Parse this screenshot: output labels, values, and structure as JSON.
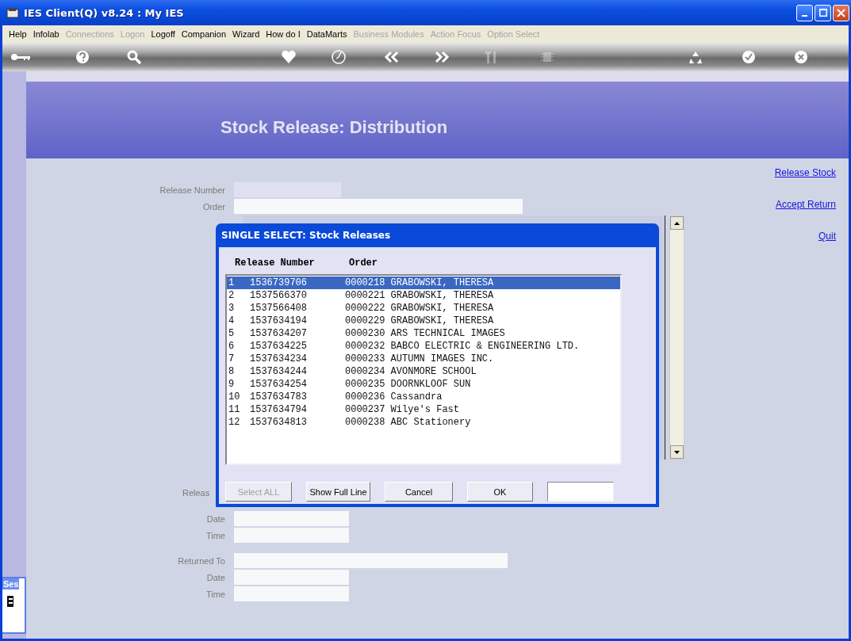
{
  "window": {
    "title": "IES Client(Q) v8.24 : My IES"
  },
  "menu": [
    {
      "label": "Help",
      "disabled": false
    },
    {
      "label": "Infolab",
      "disabled": false
    },
    {
      "label": "Connections",
      "disabled": true
    },
    {
      "label": "Logon",
      "disabled": true
    },
    {
      "label": "Logoff",
      "disabled": false
    },
    {
      "label": "Companion",
      "disabled": false
    },
    {
      "label": "Wizard",
      "disabled": false
    },
    {
      "label": "How do I",
      "disabled": false
    },
    {
      "label": "DataMarts",
      "disabled": false
    },
    {
      "label": "Business Modules",
      "disabled": true
    },
    {
      "label": "Action Focus",
      "disabled": true
    },
    {
      "label": "Option Select",
      "disabled": true
    }
  ],
  "toolbar": [
    {
      "disabled": false
    },
    {
      "disabled": false
    },
    {
      "disabled": false
    },
    {
      "disabled": false
    },
    {
      "disabled": false
    },
    {
      "disabled": false
    },
    {
      "disabled": false
    },
    {
      "disabled": true
    },
    {
      "disabled": true
    },
    {
      "disabled": false
    },
    {
      "disabled": false
    },
    {
      "disabled": false
    }
  ],
  "page": {
    "title": "Stock Release: Distribution",
    "links": [
      "Release Stock",
      "Accept Return",
      "Quit"
    ],
    "header_fields": [
      {
        "label": "Release Number",
        "readonly": true
      },
      {
        "label": "Order",
        "readonly": false
      }
    ],
    "release_label": "Releas",
    "release_fields": [
      {
        "label": "Date",
        "readonly": false
      },
      {
        "label": "Time",
        "readonly": false
      }
    ],
    "return_fields": [
      {
        "label": "Returned To",
        "readonly": false
      },
      {
        "label": "Date",
        "readonly": false
      },
      {
        "label": "Time",
        "readonly": false
      }
    ]
  },
  "side_panel": {
    "title": "Ses"
  },
  "dialog": {
    "title": "SINGLE SELECT: Stock Releases",
    "columns": [
      "Release Number",
      "Order"
    ],
    "rows": [
      {
        "index": "1",
        "release_number": "1536739706",
        "order": "0000218 GRABOWSKI, THERESA",
        "selected": true
      },
      {
        "index": "2",
        "release_number": "1537566370",
        "order": "0000221 GRABOWSKI, THERESA",
        "selected": false
      },
      {
        "index": "3",
        "release_number": "1537566408",
        "order": "0000222 GRABOWSKI, THERESA",
        "selected": false
      },
      {
        "index": "4",
        "release_number": "1537634194",
        "order": "0000229 GRABOWSKI, THERESA",
        "selected": false
      },
      {
        "index": "5",
        "release_number": "1537634207",
        "order": "0000230 ARS TECHNICAL IMAGES",
        "selected": false
      },
      {
        "index": "6",
        "release_number": "1537634225",
        "order": "0000232 BABCO ELECTRIC & ENGINEERING LTD.",
        "selected": false
      },
      {
        "index": "7",
        "release_number": "1537634234",
        "order": "0000233 AUTUMN IMAGES INC.",
        "selected": false
      },
      {
        "index": "8",
        "release_number": "1537634244",
        "order": "0000234 AVONMORE SCHOOL",
        "selected": false
      },
      {
        "index": "9",
        "release_number": "1537634254",
        "order": "0000235 DOORNKLOOF SUN",
        "selected": false
      },
      {
        "index": "10",
        "release_number": "1537634783",
        "order": "0000236 Cassandra",
        "selected": false
      },
      {
        "index": "11",
        "release_number": "1537634794",
        "order": "0000237 Wilye's Fast",
        "selected": false
      },
      {
        "index": "12",
        "release_number": "1537634813",
        "order": "0000238 ABC Stationery",
        "selected": false
      }
    ],
    "buttons": [
      {
        "label": "Select ALL",
        "disabled": true
      },
      {
        "label": "Show Full Line",
        "disabled": false
      },
      {
        "label": "Cancel",
        "disabled": false
      },
      {
        "label": "OK",
        "disabled": false
      }
    ]
  }
}
